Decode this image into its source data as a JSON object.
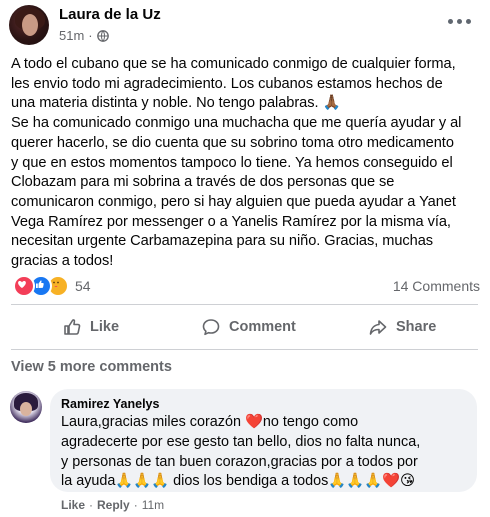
{
  "post": {
    "author": "Laura de la Uz",
    "time": "51m",
    "privacy_separator": "·",
    "privacy_icon": "globe-icon",
    "more_icon": "more-options-icon",
    "text": "A todo el cubano que se ha comunicado conmigo de cualquier forma,\nles envio todo mi agradecimiento. Los cubanos estamos hechos de\nuna materia distinta y noble. No tengo palabras. 🙏🏾\nSe ha comunicado conmigo una muchacha que me quería ayudar y al\nquerer hacerlo, se dio cuenta que su sobrino toma otro medicamento\ny que en estos momentos tampoco lo tiene. Ya hemos conseguido el\nClobazam para mi sobrina a través de dos personas que se\ncomunicaron conmigo, pero si hay alguien que pueda ayudar a Yanet\nVega Ramírez por messenger o a Yanelis Ramírez por la misma vía,\nnecesitan urgente Carbamazepina para su niño. Gracias, muchas\ngracias a todos!"
  },
  "reactions": {
    "icons": [
      "love-reaction-icon",
      "like-reaction-icon",
      "care-reaction-icon"
    ],
    "count": "54",
    "comments_count": "14 Comments"
  },
  "actions": {
    "like": "Like",
    "comment": "Comment",
    "share": "Share"
  },
  "view_more_comments": "View 5 more comments",
  "comment": {
    "author": "Ramirez Yanelys",
    "text": "Laura,gracias miles corazón ❤️no tengo como\nagradecerte por ese gesto tan bello, dios no falta nunca,\ny personas de tan buen corazon,gracias por a todos por\nla ayuda🙏🙏🙏 dios los bendiga a todos🙏🙏🙏❤️😘",
    "like_label": "Like",
    "separator": "·",
    "reply_label": "Reply",
    "time": "11m"
  },
  "colors": {
    "text": "#050505",
    "secondary": "#65676b",
    "divider": "#ced0d4",
    "bubble": "#f0f2f5",
    "love": "#f33e58",
    "like": "#1877f2",
    "care": "#f7b125"
  }
}
